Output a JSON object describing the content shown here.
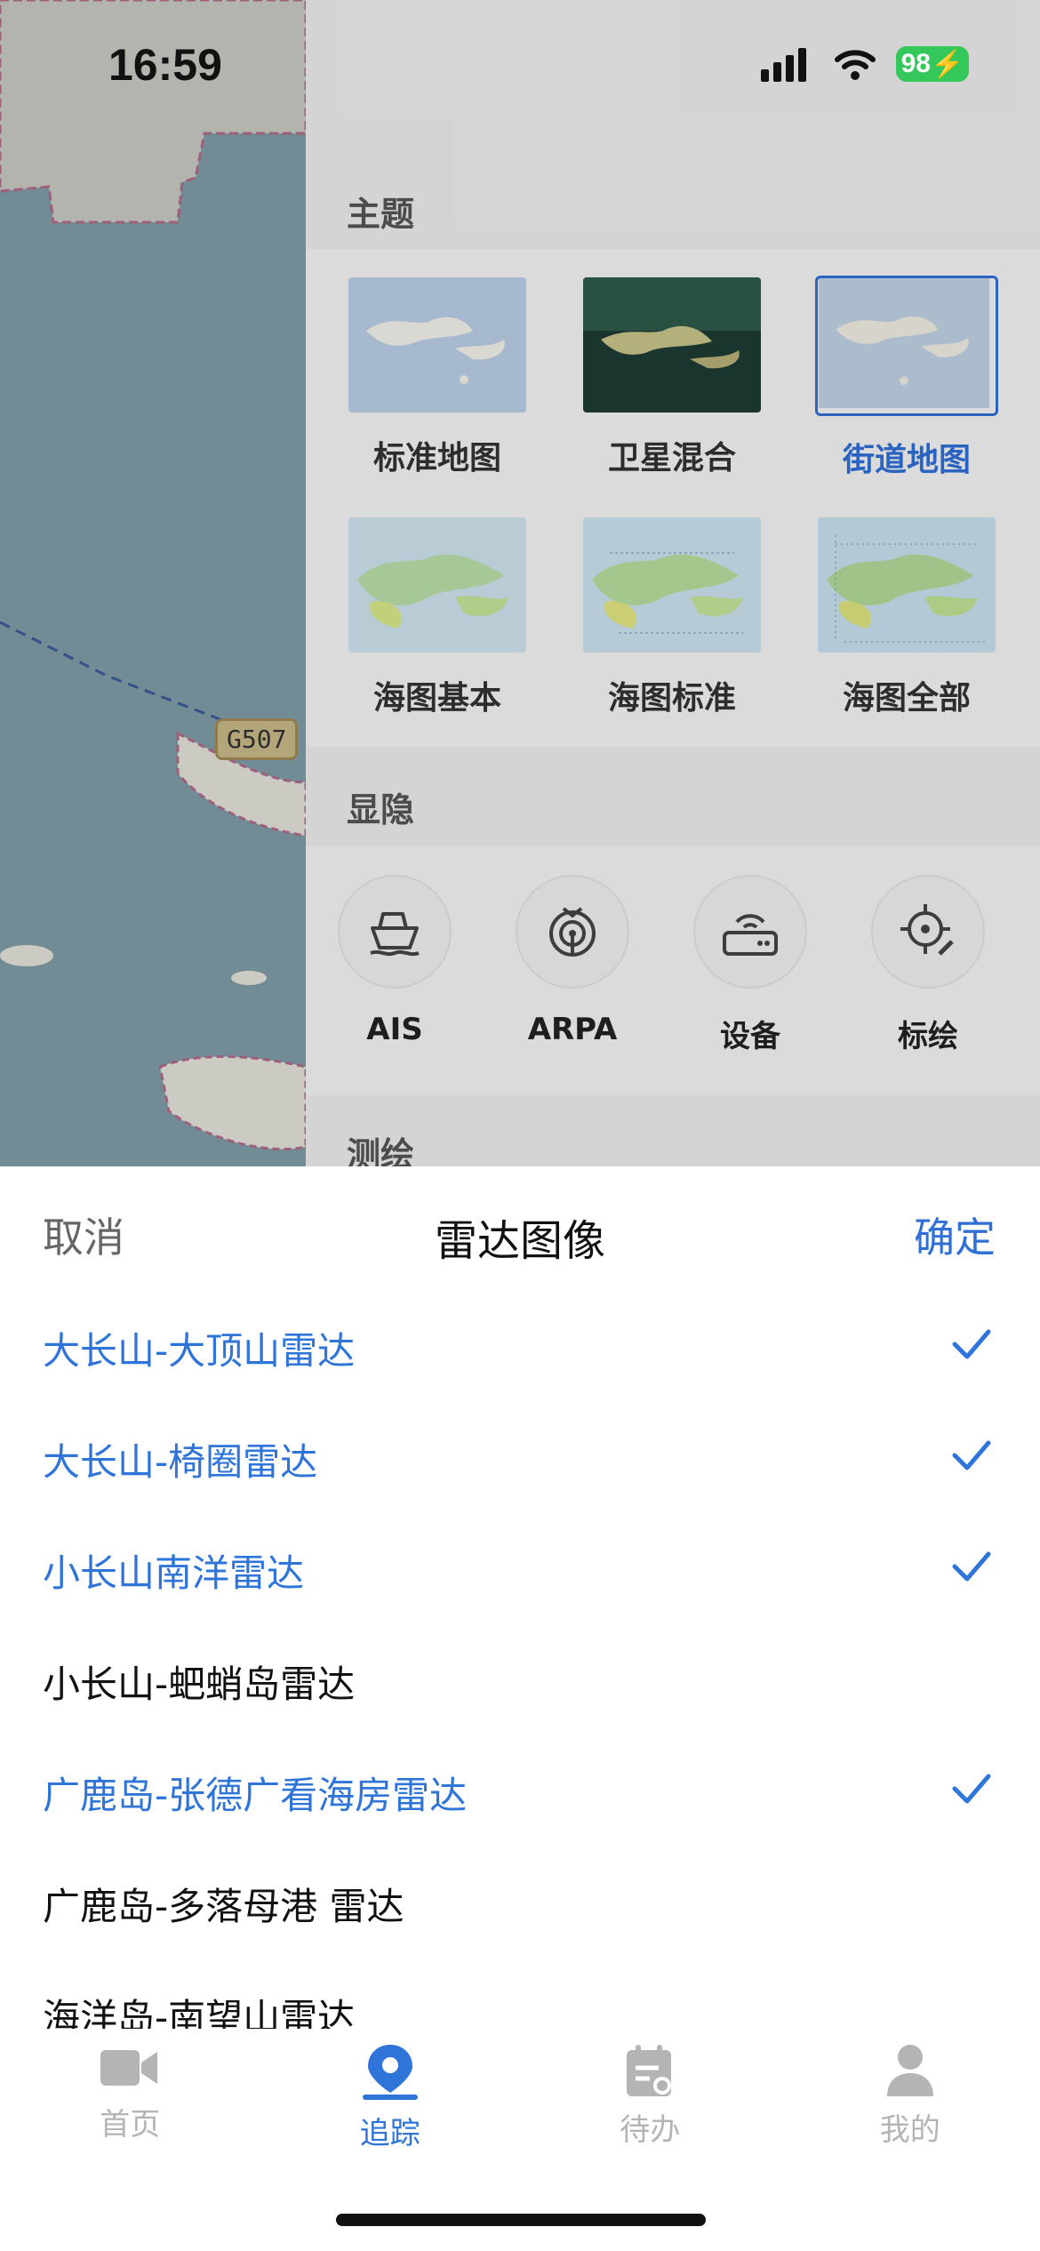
{
  "status_bar": {
    "time": "16:59",
    "battery": "98"
  },
  "map": {
    "road_label": "G507"
  },
  "panel": {
    "theme_section_title": "主题",
    "themes": [
      {
        "label": "标准地图",
        "selected": false
      },
      {
        "label": "卫星混合",
        "selected": false
      },
      {
        "label": "街道地图",
        "selected": true
      },
      {
        "label": "海图基本",
        "selected": false
      },
      {
        "label": "海图标准",
        "selected": false
      },
      {
        "label": "海图全部",
        "selected": false
      }
    ],
    "visibility_section_title": "显隐",
    "toggles": [
      {
        "label": "AIS",
        "icon": "ship-icon"
      },
      {
        "label": "ARPA",
        "icon": "radar-signal-icon"
      },
      {
        "label": "设备",
        "icon": "router-device-icon"
      },
      {
        "label": "标绘",
        "icon": "crosshair-edit-icon"
      }
    ],
    "survey_section_title": "测绘"
  },
  "sheet": {
    "cancel": "取消",
    "title": "雷达图像",
    "confirm": "确定",
    "radars": [
      {
        "name": "大长山-大顶山雷达",
        "checked": true
      },
      {
        "name": "大长山-椅圈雷达",
        "checked": true
      },
      {
        "name": "小长山南洋雷达",
        "checked": true
      },
      {
        "name": "小长山-蚆蛸岛雷达",
        "checked": false
      },
      {
        "name": "广鹿岛-张德广看海房雷达",
        "checked": true
      },
      {
        "name": "广鹿岛-多落母港 雷达",
        "checked": false
      },
      {
        "name": "海洋岛-南望山雷达",
        "checked": false
      }
    ]
  },
  "tab_bar": {
    "tabs": [
      {
        "label": "首页",
        "icon": "video-camera-icon",
        "active": false
      },
      {
        "label": "追踪",
        "icon": "location-pin-icon",
        "active": true
      },
      {
        "label": "待办",
        "icon": "task-calendar-icon",
        "active": false
      },
      {
        "label": "我的",
        "icon": "person-icon",
        "active": false
      }
    ]
  },
  "colors": {
    "accent": "#2f75d9",
    "inactive": "#b4b4b4",
    "map_water": "#7f9ca8",
    "map_land": "#e9e6dc"
  }
}
